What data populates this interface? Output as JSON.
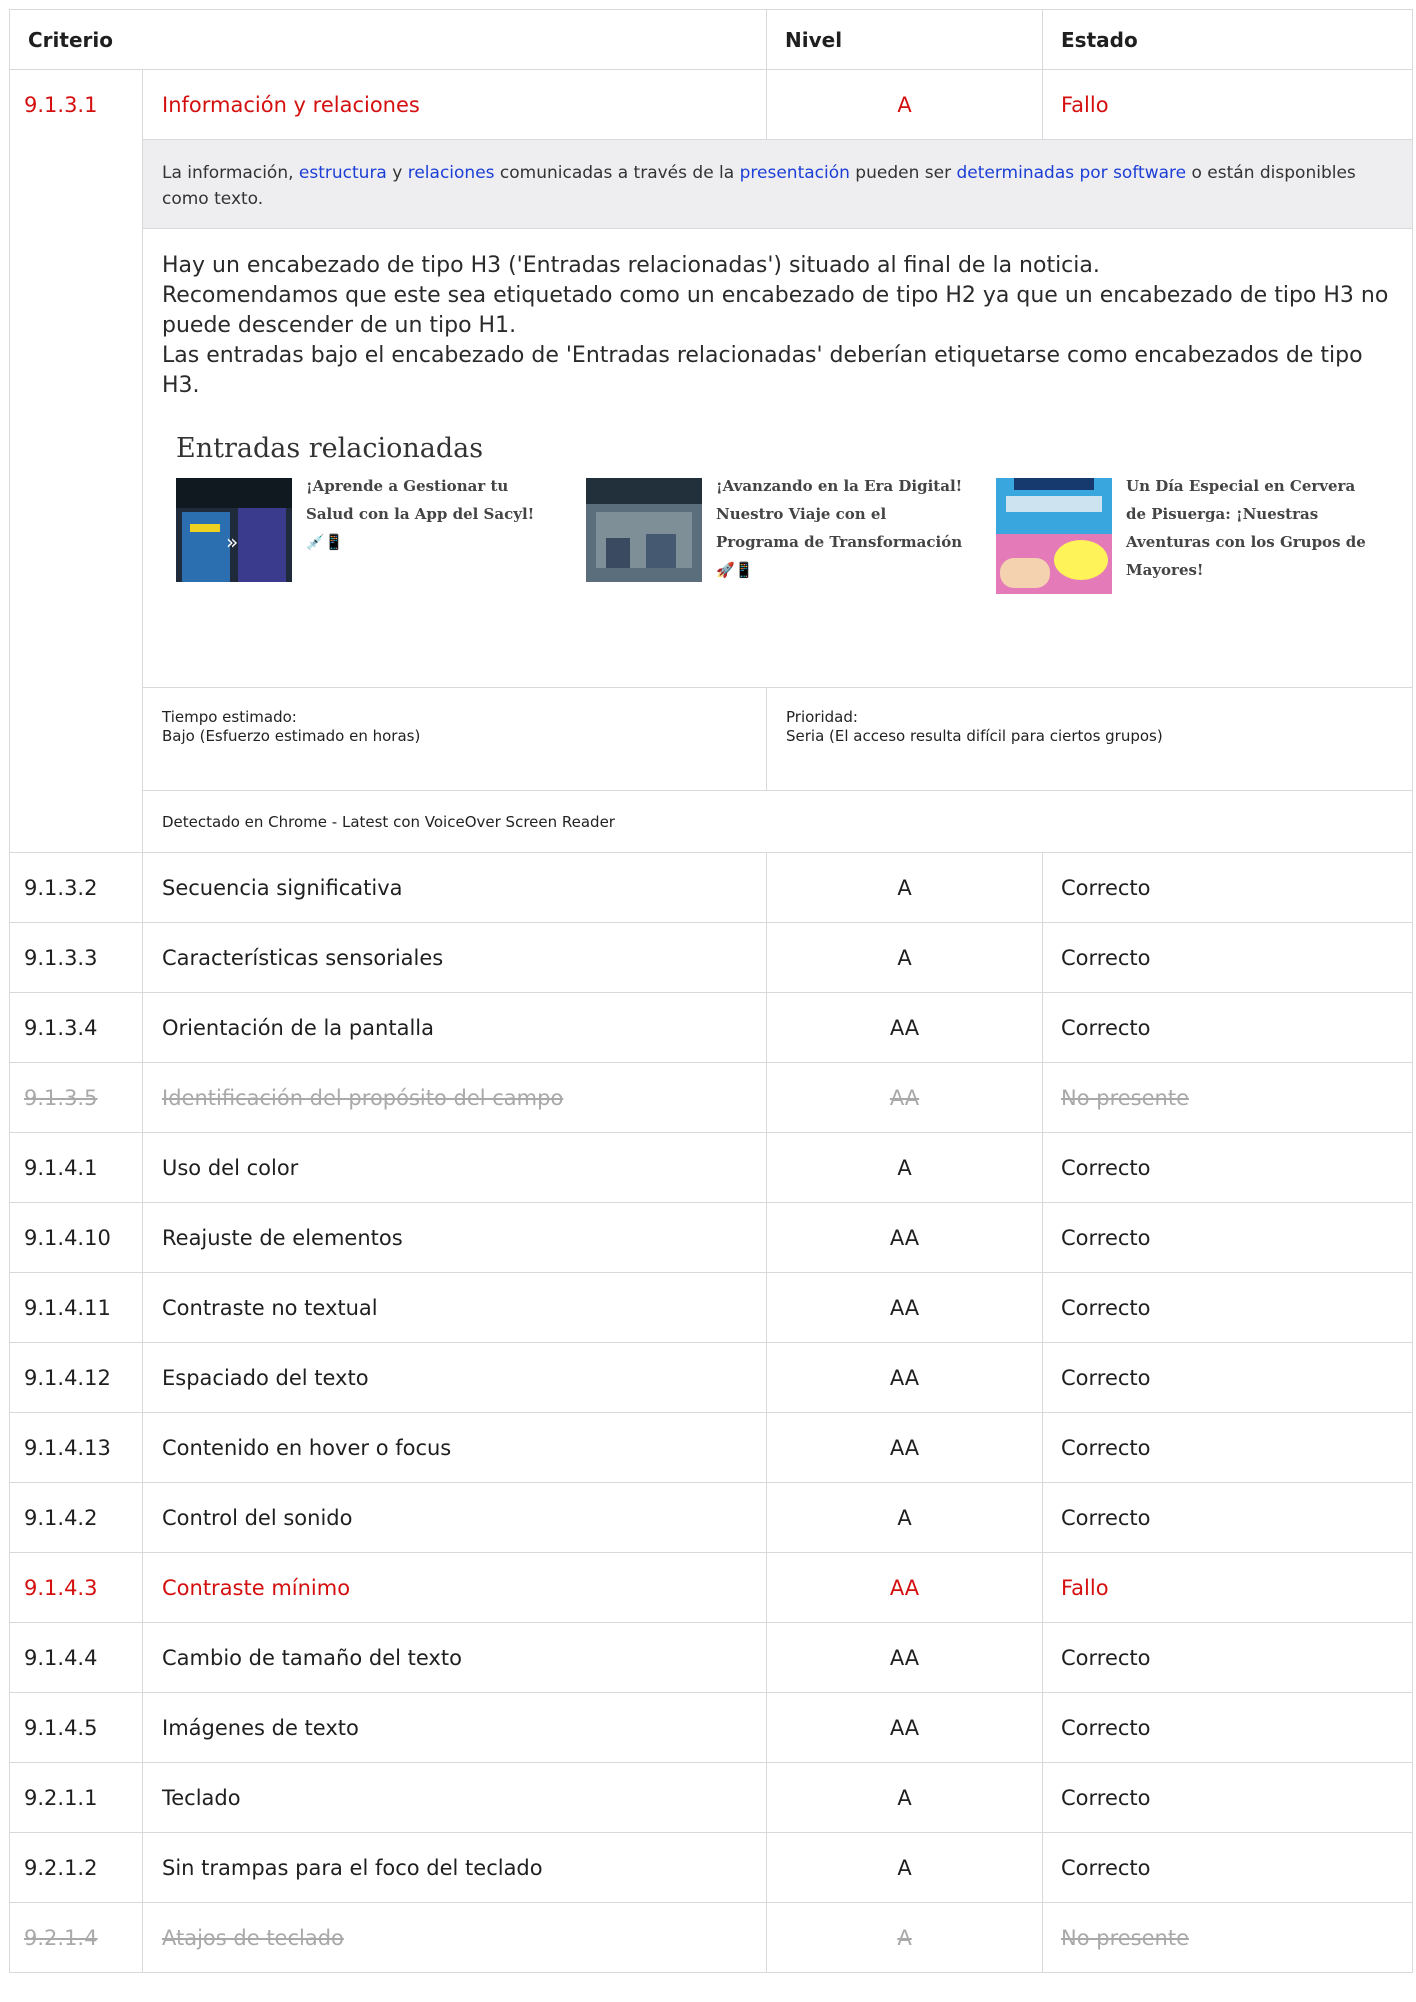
{
  "headers": {
    "criterio": "Criterio",
    "nivel": "Nivel",
    "estado": "Estado"
  },
  "expanded": {
    "id": "9.1.3.1",
    "name": "Información y relaciones",
    "level": "A",
    "status": "Fallo",
    "description": {
      "t1": "La información, ",
      "l1": "estructura",
      "t2": " y ",
      "l2": "relaciones",
      "t3": " comunicadas a través de la ",
      "l3": "presentación",
      "t4": " pueden ser ",
      "l4": "determinadas por software",
      "t5": " o están disponibles como texto."
    },
    "note": [
      "Hay un encabezado de tipo H3 ('Entradas relacionadas') situado al final de la noticia.",
      "Recomendamos que este sea etiquetado como un encabezado de tipo H2 ya que un encabezado de tipo H3 no puede descender de un tipo H1.",
      "Las entradas bajo el encabezado de 'Entradas relacionadas' deberían etiquetarse como encabezados de tipo H3."
    ],
    "related": {
      "heading": "Entradas relacionadas",
      "items": [
        {
          "title": "¡Aprende a Gestionar tu Salud con la App del Sacyl! 💉📱"
        },
        {
          "title": "¡Avanzando en la Era Digital! Nuestro Viaje con el Programa de Transformación 🚀📱"
        },
        {
          "title": "Un Día Especial en Cervera de Pisuerga: ¡Nuestras Aventuras con los Grupos de Mayores!"
        }
      ]
    },
    "tiempo_label": "Tiempo estimado:",
    "tiempo_value": "Bajo (Esfuerzo estimado en horas)",
    "prioridad_label": "Prioridad:",
    "prioridad_value": "Seria (El acceso resulta difícil para ciertos grupos)",
    "detected": "Detectado en Chrome - Latest con VoiceOver Screen Reader"
  },
  "rows": [
    {
      "id": "9.1.3.2",
      "name": "Secuencia significativa",
      "level": "A",
      "status": "Correcto",
      "state": "ok"
    },
    {
      "id": "9.1.3.3",
      "name": "Características sensoriales",
      "level": "A",
      "status": "Correcto",
      "state": "ok"
    },
    {
      "id": "9.1.3.4",
      "name": "Orientación de la pantalla",
      "level": "AA",
      "status": "Correcto",
      "state": "ok"
    },
    {
      "id": "9.1.3.5",
      "name": "Identificación del propósito del campo",
      "level": "AA",
      "status": "No presente",
      "state": "absent"
    },
    {
      "id": "9.1.4.1",
      "name": "Uso del color",
      "level": "A",
      "status": "Correcto",
      "state": "ok"
    },
    {
      "id": "9.1.4.10",
      "name": "Reajuste de elementos",
      "level": "AA",
      "status": "Correcto",
      "state": "ok"
    },
    {
      "id": "9.1.4.11",
      "name": "Contraste no textual",
      "level": "AA",
      "status": "Correcto",
      "state": "ok"
    },
    {
      "id": "9.1.4.12",
      "name": "Espaciado del texto",
      "level": "AA",
      "status": "Correcto",
      "state": "ok"
    },
    {
      "id": "9.1.4.13",
      "name": "Contenido en hover o focus",
      "level": "AA",
      "status": "Correcto",
      "state": "ok"
    },
    {
      "id": "9.1.4.2",
      "name": "Control del sonido",
      "level": "A",
      "status": "Correcto",
      "state": "ok"
    },
    {
      "id": "9.1.4.3",
      "name": "Contraste mínimo",
      "level": "AA",
      "status": "Fallo",
      "state": "fail"
    },
    {
      "id": "9.1.4.4",
      "name": "Cambio de tamaño del texto",
      "level": "AA",
      "status": "Correcto",
      "state": "ok"
    },
    {
      "id": "9.1.4.5",
      "name": "Imágenes de texto",
      "level": "AA",
      "status": "Correcto",
      "state": "ok"
    },
    {
      "id": "9.2.1.1",
      "name": "Teclado",
      "level": "A",
      "status": "Correcto",
      "state": "ok"
    },
    {
      "id": "9.2.1.2",
      "name": "Sin trampas para el foco del teclado",
      "level": "A",
      "status": "Correcto",
      "state": "ok"
    },
    {
      "id": "9.2.1.4",
      "name": "Atajos de teclado",
      "level": "A",
      "status": "No presente",
      "state": "absent"
    }
  ],
  "colors": {
    "fail": "#d40f0f",
    "link": "#1b3ed6",
    "absent": "#a9a9a9",
    "desc_bg": "#eeeef0",
    "border": "#d9d9d9"
  }
}
